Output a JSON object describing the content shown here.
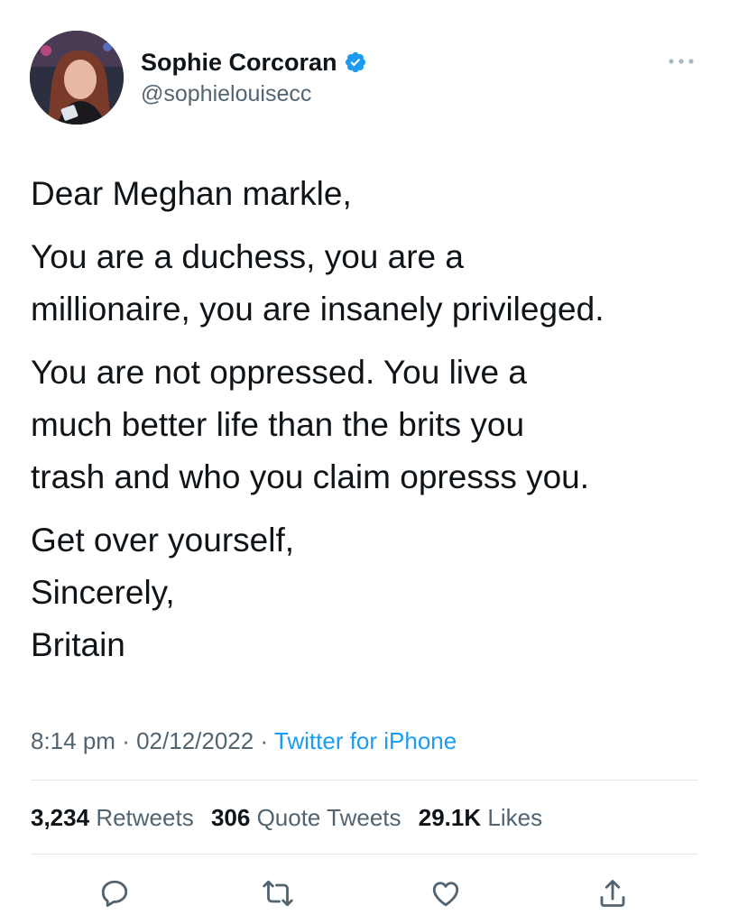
{
  "author": {
    "display_name": "Sophie Corcoran",
    "handle": "@sophielouisecc",
    "verified": true,
    "avatar_icon": "profile-photo"
  },
  "tweet": {
    "paragraphs": [
      [
        "Dear Meghan markle,"
      ],
      [
        "You are a duchess, you are a",
        "millionaire, you are insanely privileged."
      ],
      [
        "You are not oppressed. You live a",
        "much better life than the brits you",
        "trash and who you claim opresss you."
      ],
      [
        "Get over yourself,",
        "Sincerely,",
        "Britain"
      ]
    ]
  },
  "meta": {
    "time": "8:14 pm",
    "separator": "·",
    "date": "02/12/2022",
    "source": "Twitter for iPhone"
  },
  "stats": {
    "retweets_count": "3,234",
    "retweets_label": "Retweets",
    "quotes_count": "306",
    "quotes_label": "Quote Tweets",
    "likes_count": "29.1K",
    "likes_label": "Likes"
  },
  "actions": [
    "reply-icon",
    "retweet-icon",
    "like-icon",
    "share-icon"
  ],
  "colors": {
    "text": "#0f1419",
    "secondary": "#536471",
    "link": "#1d9bf0",
    "divider": "#e1e8ed",
    "verified_badge": "#1d9bf0"
  }
}
